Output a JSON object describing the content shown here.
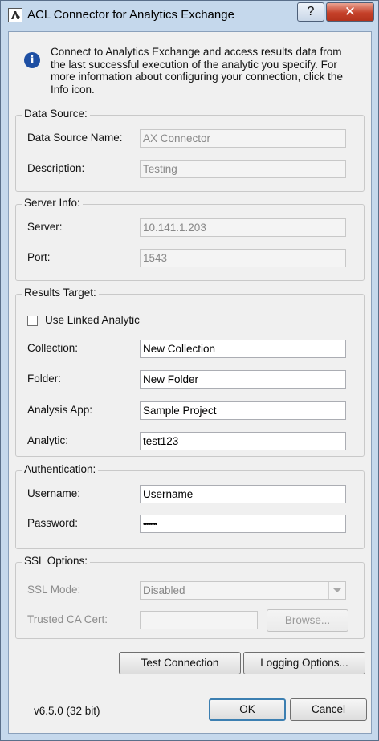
{
  "window": {
    "title": "ACL Connector for Analytics Exchange",
    "help_label": "?",
    "close_label": "✕"
  },
  "info": {
    "icon": "info-icon",
    "text": "Connect to Analytics Exchange and access results data from the last successful execution of the analytic you specify. For more information about configuring your connection, click the Info icon."
  },
  "data_source": {
    "title": "Data Source:",
    "name_label": "Data Source Name:",
    "name_value": "AX Connector",
    "description_label": "Description:",
    "description_value": "Testing"
  },
  "server_info": {
    "title": "Server Info:",
    "server_label": "Server:",
    "server_value": "10.141.1.203",
    "port_label": "Port:",
    "port_value": "1543"
  },
  "results_target": {
    "title": "Results Target:",
    "use_linked_label": "Use Linked Analytic",
    "use_linked_checked": false,
    "collection_label": "Collection:",
    "collection_value": "New Collection",
    "folder_label": "Folder:",
    "folder_value": "New Folder",
    "analysis_app_label": "Analysis App:",
    "analysis_app_value": "Sample Project",
    "analytic_label": "Analytic:",
    "analytic_value": "test123"
  },
  "authentication": {
    "title": "Authentication:",
    "username_label": "Username:",
    "username_value": "Username",
    "password_label": "Password:",
    "password_value": "••••••••"
  },
  "ssl_options": {
    "title": "SSL Options:",
    "mode_label": "SSL Mode:",
    "mode_value": "Disabled",
    "trusted_ca_label": "Trusted CA Cert:",
    "trusted_ca_value": "",
    "browse_label": "Browse..."
  },
  "buttons": {
    "test_connection": "Test Connection",
    "logging_options": "Logging Options...",
    "ok": "OK",
    "cancel": "Cancel"
  },
  "footer": {
    "version": "v6.5.0 (32 bit)"
  }
}
